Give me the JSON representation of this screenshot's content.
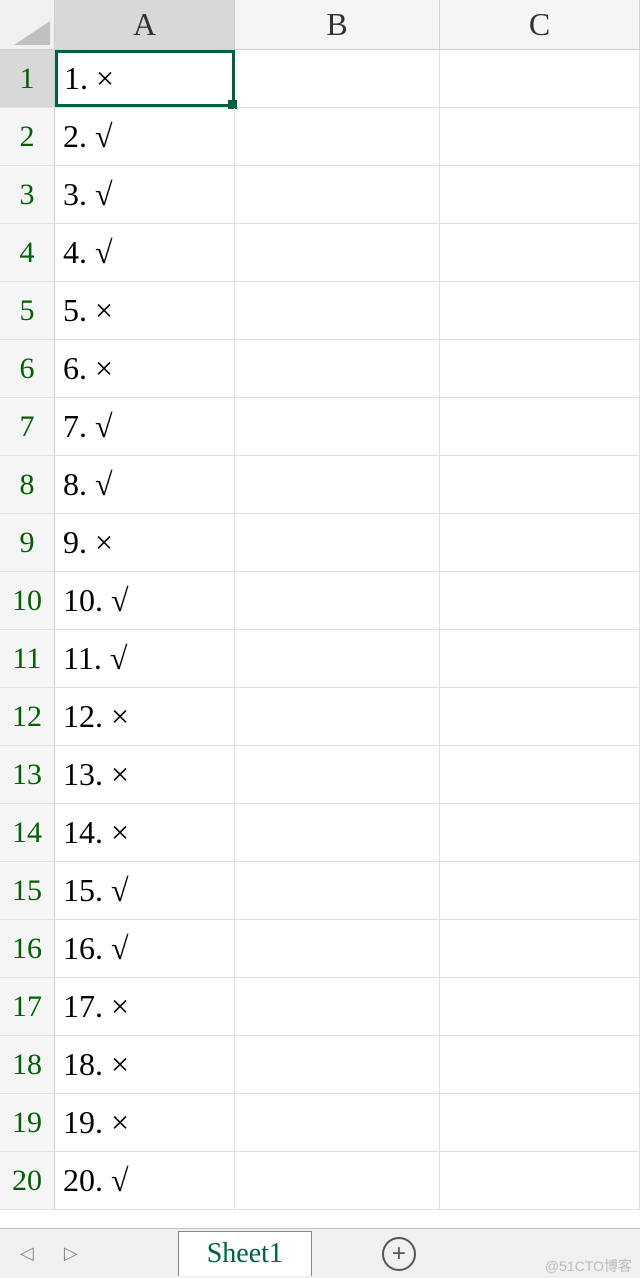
{
  "columns": [
    "A",
    "B",
    "C"
  ],
  "selected_col": "A",
  "selected_row": 1,
  "rows": [
    {
      "n": 1,
      "value": "1. ×"
    },
    {
      "n": 2,
      "value": "2. √"
    },
    {
      "n": 3,
      "value": "3. √"
    },
    {
      "n": 4,
      "value": "4. √"
    },
    {
      "n": 5,
      "value": "5. ×"
    },
    {
      "n": 6,
      "value": "6. ×"
    },
    {
      "n": 7,
      "value": "7. √"
    },
    {
      "n": 8,
      "value": "8. √"
    },
    {
      "n": 9,
      "value": "9. ×"
    },
    {
      "n": 10,
      "value": "10. √"
    },
    {
      "n": 11,
      "value": "11. √"
    },
    {
      "n": 12,
      "value": "12. ×"
    },
    {
      "n": 13,
      "value": "13. ×"
    },
    {
      "n": 14,
      "value": "14. ×"
    },
    {
      "n": 15,
      "value": "15. √"
    },
    {
      "n": 16,
      "value": "16. √"
    },
    {
      "n": 17,
      "value": "17. ×"
    },
    {
      "n": 18,
      "value": "18. ×"
    },
    {
      "n": 19,
      "value": "19. ×"
    },
    {
      "n": 20,
      "value": "20. √"
    }
  ],
  "sheet_tab": "Sheet1",
  "watermark": "@51CTO博客"
}
